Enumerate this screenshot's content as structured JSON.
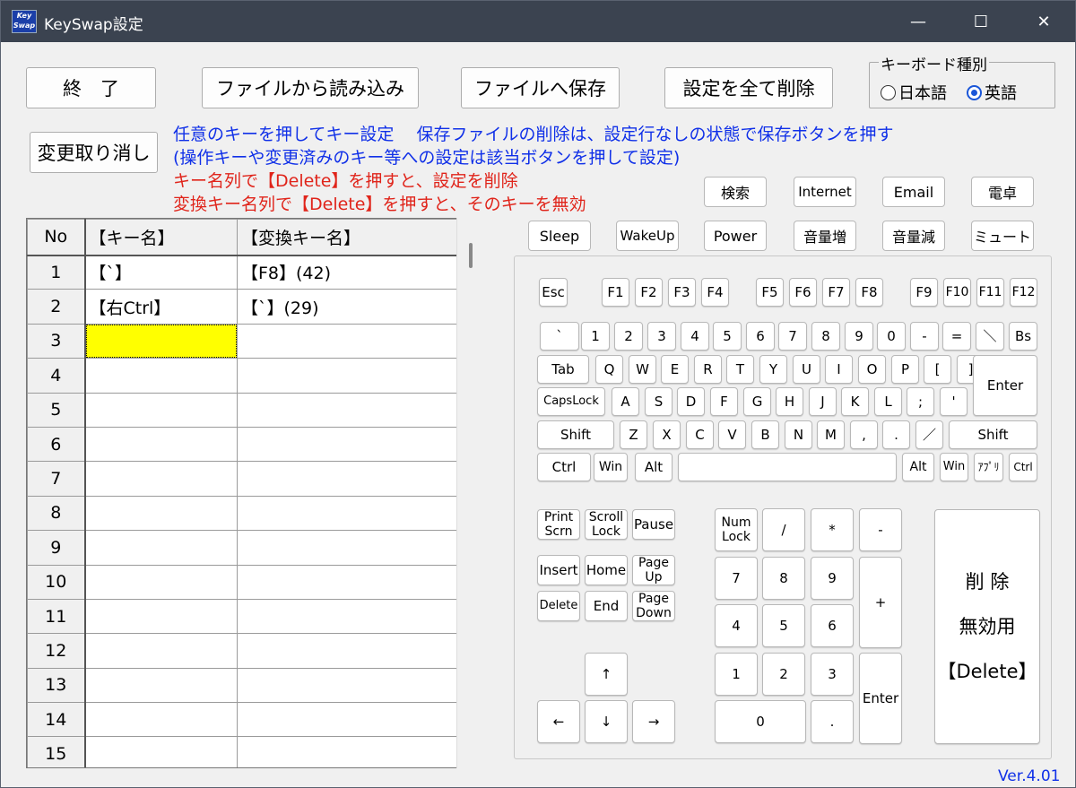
{
  "window": {
    "title": "KeySwap設定",
    "icon_text": "Key Swap"
  },
  "window_controls": {
    "minimize": "—",
    "maximize": "☐",
    "close": "✕"
  },
  "toolbar": {
    "exit": "終　了",
    "load": "ファイルから読み込み",
    "save": "ファイルへ保存",
    "delete_all": "設定を全て削除",
    "undo": "変更取り消し"
  },
  "notes": {
    "blue": "任意のキーを押してキー設定　 保存ファイルの削除は、設定行なしの状態で保存ボタンを押す\n(操作キーや変更済みのキー等への設定は該当ボタンを押して設定)",
    "red": "キー名列で【Delete】を押すと、設定を削除\n変換キー名列で【Delete】を押すと、そのキーを無効"
  },
  "keyboard_type": {
    "label": "キーボード種別",
    "options": [
      "日本語",
      "英語"
    ],
    "selected": "英語"
  },
  "grid": {
    "headers": [
      "No",
      "【キー名】",
      "【変換キー名】"
    ],
    "rows": [
      [
        "1",
        "【`】",
        "【F8】(42)"
      ],
      [
        "2",
        "【右Ctrl】",
        "【`】(29)"
      ],
      [
        "3",
        "",
        ""
      ],
      [
        "4",
        "",
        ""
      ],
      [
        "5",
        "",
        ""
      ],
      [
        "6",
        "",
        ""
      ],
      [
        "7",
        "",
        ""
      ],
      [
        "8",
        "",
        ""
      ],
      [
        "9",
        "",
        ""
      ],
      [
        "10",
        "",
        ""
      ],
      [
        "11",
        "",
        ""
      ],
      [
        "12",
        "",
        ""
      ],
      [
        "13",
        "",
        ""
      ],
      [
        "14",
        "",
        ""
      ],
      [
        "15",
        "",
        ""
      ]
    ],
    "selected_row": 3
  },
  "func_keys": {
    "row1": [
      "検索",
      "Internet",
      "Email",
      "電卓"
    ],
    "row2": [
      "Sleep",
      "WakeUp",
      "Power",
      "音量増",
      "音量減",
      "ミュート"
    ]
  },
  "keyboard": {
    "esc": "Esc",
    "f": [
      "F1",
      "F2",
      "F3",
      "F4",
      "F5",
      "F6",
      "F7",
      "F8",
      "F9",
      "F10",
      "F11",
      "F12"
    ],
    "num_row": [
      "`",
      "1",
      "2",
      "3",
      "4",
      "5",
      "6",
      "7",
      "8",
      "9",
      "0",
      "-",
      "=",
      "＼",
      "Bs"
    ],
    "q_row": [
      "Tab",
      "Q",
      "W",
      "E",
      "R",
      "T",
      "Y",
      "U",
      "I",
      "O",
      "P",
      "[",
      "]"
    ],
    "a_row": [
      "CapsLock",
      "A",
      "S",
      "D",
      "F",
      "G",
      "H",
      "J",
      "K",
      "L",
      ";",
      "'"
    ],
    "enter": "Enter",
    "z_row": [
      "Shift",
      "Z",
      "X",
      "C",
      "V",
      "B",
      "N",
      "M",
      ",",
      ".",
      "／",
      "Shift"
    ],
    "bottom": [
      "Ctrl",
      "Win",
      "Alt",
      "",
      "Alt",
      "Win",
      "ｱﾌﾟﾘ",
      "Ctrl"
    ],
    "nav": [
      "Print Scrn",
      "Scroll Lock",
      "Pause",
      "Insert",
      "Home",
      "Page Up",
      "Delete",
      "End",
      "Page Down"
    ],
    "arrows": [
      "↑",
      "←",
      "↓",
      "→"
    ],
    "numpad": [
      "Num Lock",
      "/",
      "*",
      "-",
      "7",
      "8",
      "9",
      "+",
      "4",
      "5",
      "6",
      "1",
      "2",
      "3",
      "Enter",
      "0",
      "."
    ],
    "delete_panel": {
      "line1": "削 除",
      "line2": "無効用",
      "line3": "【Delete】"
    }
  },
  "version": "Ver.4.01"
}
